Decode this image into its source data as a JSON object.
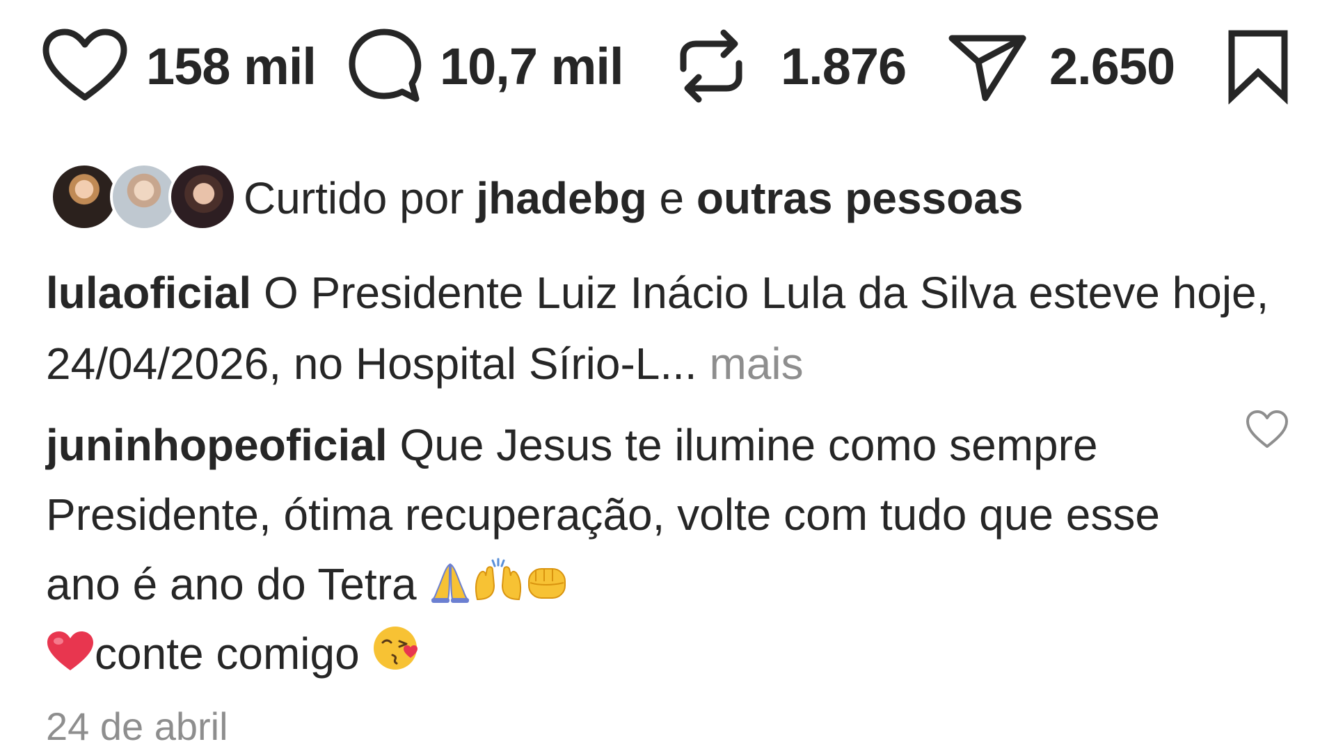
{
  "actions": {
    "like_count": "158 mil",
    "comment_count": "10,7 mil",
    "repost_count": "1.876",
    "share_count": "2.650"
  },
  "liked_by": {
    "prefix": "Curtido por ",
    "user": "jhadebg",
    "connector": " e ",
    "others": "outras pessoas"
  },
  "caption": {
    "username": "lulaoficial",
    "text": " O Presidente Luiz Inácio Lula da Silva esteve hoje, 24/04/2026, no Hospital Sírio-L...",
    "more": " mais"
  },
  "comment": {
    "username": "juninhopeoficial",
    "text_part1": " Que Jesus te ilumine como sempre Presidente, ótima recuperação, volte com tudo que esse ano é ano do Tetra ",
    "text_part2": "conte comigo ",
    "emojis": [
      "folded-hands",
      "raising-hands",
      "oncoming-fist",
      "red-heart",
      "face-blowing-kiss"
    ]
  },
  "timestamp": "24 de abril",
  "icons": {
    "like": "heart-icon",
    "comment": "comment-bubble-icon",
    "repost": "repost-icon",
    "share": "send-icon",
    "save": "bookmark-icon"
  },
  "colors": {
    "text": "#262626",
    "muted": "#8e8e8e",
    "background": "#ffffff"
  }
}
